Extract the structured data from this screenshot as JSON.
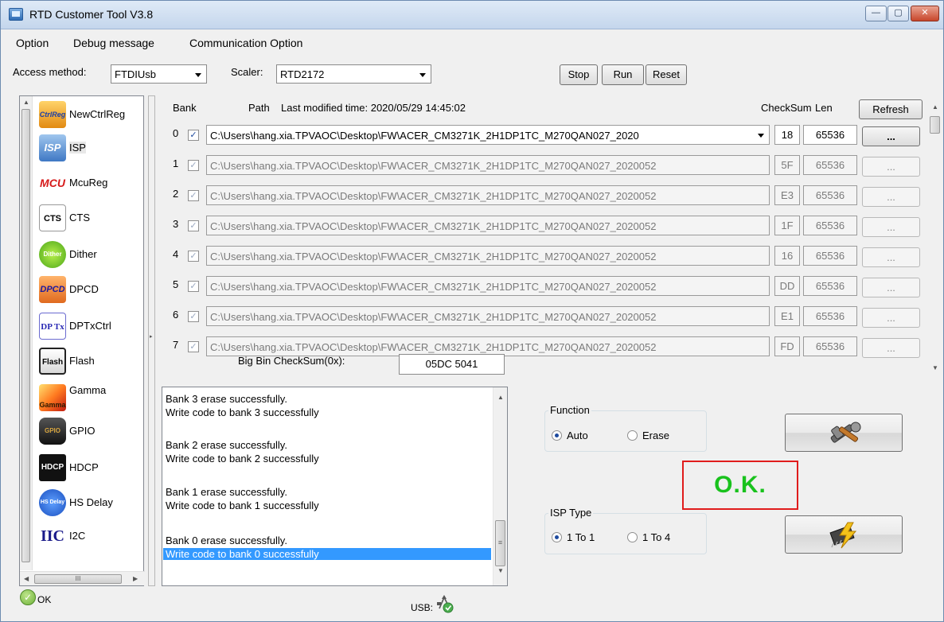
{
  "window": {
    "title": "RTD Customer Tool V3.8",
    "controls": {
      "minimize": "—",
      "maximize": "▢",
      "close": "✕"
    }
  },
  "menu": [
    "Option",
    "Debug message",
    "Communication Option"
  ],
  "toolbar": {
    "access_label": "Access method:",
    "access_value": "FTDIUsb",
    "scaler_label": "Scaler:",
    "scaler_value": "RTD2172",
    "stop": "Stop",
    "run": "Run",
    "reset": "Reset"
  },
  "sidebar": {
    "items": [
      {
        "label": "NewCtrlReg",
        "icon": "ctrlreg-icon",
        "icon_text": "CtrlReg"
      },
      {
        "label": "ISP",
        "icon": "isp-icon",
        "icon_text": "ISP"
      },
      {
        "label": "McuReg",
        "icon": "mcu-icon",
        "icon_text": "MCU"
      },
      {
        "label": "CTS",
        "icon": "cts-icon",
        "icon_text": "CTS"
      },
      {
        "label": "Dither",
        "icon": "dither-icon",
        "icon_text": "Dither"
      },
      {
        "label": "DPCD",
        "icon": "dpcd-icon",
        "icon_text": "DPCD"
      },
      {
        "label": "DPTxCtrl",
        "icon": "dptx-icon",
        "icon_text": "DP Tx"
      },
      {
        "label": "Flash",
        "icon": "flash-icon",
        "icon_text": "Flash"
      },
      {
        "label": "Gamma",
        "icon": "gamma-icon",
        "icon_text": "Gamma"
      },
      {
        "label": "GPIO",
        "icon": "gpio-icon",
        "icon_text": "GPIO"
      },
      {
        "label": "HDCP",
        "icon": "hdcp-icon",
        "icon_text": "HDCP"
      },
      {
        "label": "HS Delay",
        "icon": "hsdelay-icon",
        "icon_text": "HS Delay"
      },
      {
        "label": "I2C",
        "icon": "i2c-icon",
        "icon_text": "IIC"
      }
    ],
    "hscroll_mark": "III"
  },
  "bank": {
    "header_bank": "Bank",
    "header_path": "Path",
    "modified_label": "Last modified time: 2020/05/29 14:45:02",
    "header_checksum": "CheckSum",
    "header_len": "Len",
    "refresh": "Refresh",
    "rows": [
      {
        "num": "0",
        "path": "C:\\Users\\hang.xia.TPVAOC\\Desktop\\FW\\ACER_CM3271K_2H1DP1TC_M270QAN027_2020",
        "checksum": "18",
        "len": "65536",
        "dots": "...",
        "checked": "✓"
      },
      {
        "num": "1",
        "path": "C:\\Users\\hang.xia.TPVAOC\\Desktop\\FW\\ACER_CM3271K_2H1DP1TC_M270QAN027_2020052",
        "checksum": "5F",
        "len": "65536",
        "dots": "...",
        "checked": "✓"
      },
      {
        "num": "2",
        "path": "C:\\Users\\hang.xia.TPVAOC\\Desktop\\FW\\ACER_CM3271K_2H1DP1TC_M270QAN027_2020052",
        "checksum": "E3",
        "len": "65536",
        "dots": "...",
        "checked": "✓"
      },
      {
        "num": "3",
        "path": "C:\\Users\\hang.xia.TPVAOC\\Desktop\\FW\\ACER_CM3271K_2H1DP1TC_M270QAN027_2020052",
        "checksum": "1F",
        "len": "65536",
        "dots": "...",
        "checked": "✓"
      },
      {
        "num": "4",
        "path": "C:\\Users\\hang.xia.TPVAOC\\Desktop\\FW\\ACER_CM3271K_2H1DP1TC_M270QAN027_2020052",
        "checksum": "16",
        "len": "65536",
        "dots": "...",
        "checked": "✓"
      },
      {
        "num": "5",
        "path": "C:\\Users\\hang.xia.TPVAOC\\Desktop\\FW\\ACER_CM3271K_2H1DP1TC_M270QAN027_2020052",
        "checksum": "DD",
        "len": "65536",
        "dots": "...",
        "checked": "✓"
      },
      {
        "num": "6",
        "path": "C:\\Users\\hang.xia.TPVAOC\\Desktop\\FW\\ACER_CM3271K_2H1DP1TC_M270QAN027_2020052",
        "checksum": "E1",
        "len": "65536",
        "dots": "...",
        "checked": "✓"
      },
      {
        "num": "7",
        "path": "C:\\Users\\hang.xia.TPVAOC\\Desktop\\FW\\ACER_CM3271K_2H1DP1TC_M270QAN027_2020052",
        "checksum": "FD",
        "len": "65536",
        "dots": "...",
        "checked": "✓"
      }
    ],
    "big_bin_label": "Big Bin CheckSum(0x):",
    "big_bin_value": "05DC 5041"
  },
  "log": {
    "lines": [
      "Bank 3 erase successfully.",
      "Write code to bank 3 successfully",
      "Bank 2 erase successfully.",
      "Write code to bank 2 successfully",
      "Bank 1 erase successfully.",
      "Write code to bank 1 successfully",
      "Bank 0 erase successfully.",
      "Write code to bank 0 successfully"
    ]
  },
  "function": {
    "title": "Function",
    "auto": "Auto",
    "erase": "Erase",
    "selected": "Auto"
  },
  "isp_type": {
    "title": "ISP Type",
    "one_to_one": "1 To 1",
    "one_to_four": "1 To 4",
    "selected": "1 To 1"
  },
  "result": {
    "text": "O.K.",
    "color": "#19c21d",
    "border": "#e01c1c"
  },
  "status": {
    "ok": "OK",
    "usb": "USB:"
  }
}
